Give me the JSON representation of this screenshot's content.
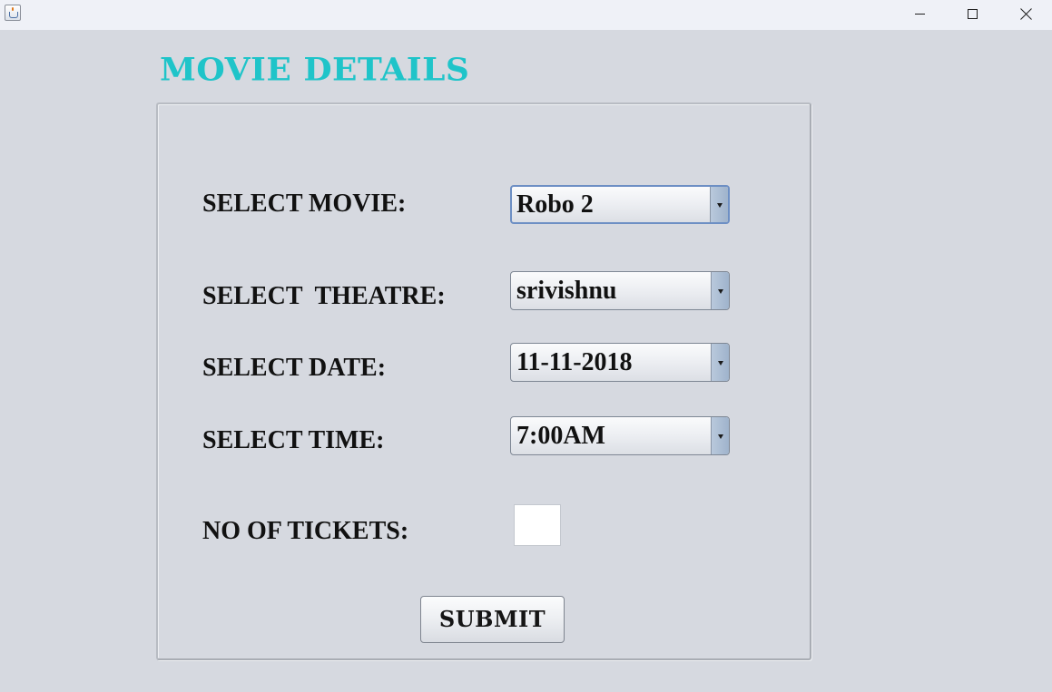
{
  "window": {
    "controls": [
      "minimize-icon",
      "maximize-icon",
      "close-icon"
    ]
  },
  "page": {
    "title": "MOVIE DETAILS",
    "title_color": "#1fc4c9"
  },
  "form": {
    "movie": {
      "label": "SELECT MOVIE:",
      "value": "Robo 2"
    },
    "theatre": {
      "label": "SELECT  THEATRE:",
      "value": "srivishnu"
    },
    "date": {
      "label": "SELECT DATE:",
      "value": "11-11-2018"
    },
    "time": {
      "label": "SELECT TIME:",
      "value": "7:00AM"
    },
    "tickets": {
      "label": "NO OF TICKETS:",
      "value": ""
    },
    "submit_label": "SUBMIT"
  }
}
